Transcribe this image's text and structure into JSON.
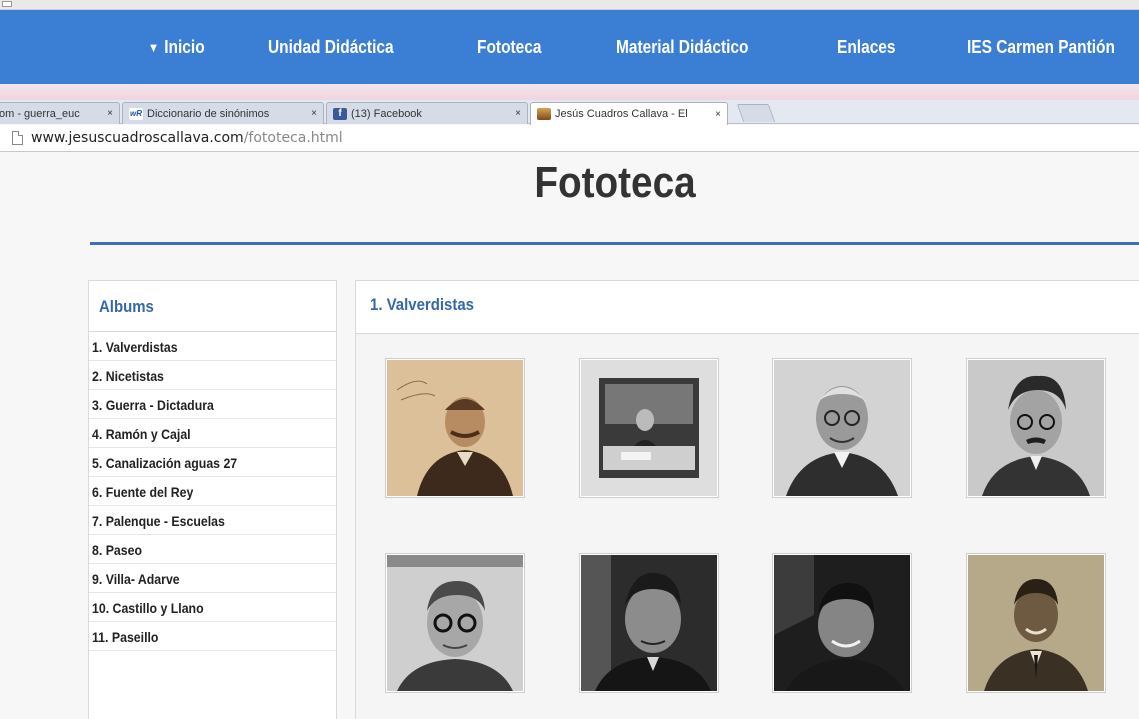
{
  "nav": {
    "items": [
      {
        "label": "Inicio",
        "caret": "▼"
      },
      {
        "label": "Unidad Didáctica"
      },
      {
        "label": "Fototeca"
      },
      {
        "label": "Material Didáctico"
      },
      {
        "label": "Enlaces"
      },
      {
        "label": "IES Carmen Pantión"
      }
    ]
  },
  "browser": {
    "tabs": [
      {
        "title": "om - guerra_euc",
        "close": "×"
      },
      {
        "title": "Diccionario de sinónimos",
        "close": "×",
        "favicon": "wR"
      },
      {
        "title": "(13) Facebook",
        "close": "×",
        "favicon": "f"
      },
      {
        "title": "Jesús Cuadros Callava - El",
        "close": "×"
      }
    ],
    "url_host": "www.jesuscuadroscallava.com",
    "url_path": "/fototeca.html"
  },
  "page": {
    "title": "Fototeca",
    "albums_heading": "Albums",
    "albums": [
      "1. Valverdistas",
      "2. Nicetistas",
      "3. Guerra - Dictadura",
      "4. Ramón y Cajal",
      "5. Canalización aguas 27",
      "6. Fuente del Rey",
      "7. Palenque - Escuelas",
      "8. Paseo",
      "9. Villa- Adarve",
      "10. Castillo y Llano",
      "11. Paseillo"
    ],
    "gallery_heading": "1. Valverdistas",
    "photos": [
      {
        "tone": "sepia",
        "subject": "mustached-man-portrait"
      },
      {
        "tone": "gray",
        "subject": "man-at-desk"
      },
      {
        "tone": "gray",
        "subject": "man-with-glasses-smiling"
      },
      {
        "tone": "gray",
        "subject": "man-with-glasses-mustache"
      },
      {
        "tone": "gray",
        "subject": "man-with-round-glasses"
      },
      {
        "tone": "dark",
        "subject": "man-in-suit"
      },
      {
        "tone": "dark",
        "subject": "smiling-man-dark"
      },
      {
        "tone": "sepia",
        "subject": "smiling-man-tie"
      }
    ]
  },
  "colors": {
    "nav_bg": "#3b7fd5",
    "heading_blue": "#3568a8",
    "title_rule": "#3b6fb8"
  }
}
